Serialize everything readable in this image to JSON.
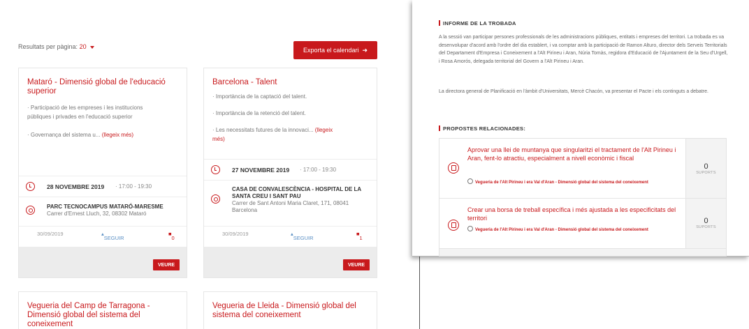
{
  "left": {
    "per_page_label": "Resultats per pàgina:",
    "per_page_value": "20",
    "export_label": "Exporta el calendari",
    "export_icon": "arrow-right-icon",
    "cards": [
      {
        "title": "Mataró - Dimensió global de l'educació superior",
        "lines": [
          "· Participació de les empreses i les institucions",
          "públiques i privades en l'educació superior",
          "· Governança del sistema u..."
        ],
        "more": "(llegeix més)",
        "date": "28 NOVEMBRE 2019",
        "time": "· 17:00 - 19:30",
        "place": "PARC TECNOCAMPUS MATARÓ-MARESME",
        "address": "Carrer d'Ernest Lluch, 32, 08302 Mataró",
        "pub_date": "30/09/2019",
        "follow": "SEGUIR",
        "count": "0",
        "button": "VEURE"
      },
      {
        "title": "Barcelona - Talent",
        "lines": [
          "· Importància de la captació del talent.",
          "· Importància de la retenció del talent.",
          "· Les necessitats futures de la innovaci..."
        ],
        "more": "(llegeix",
        "more2": "més)",
        "date": "27 NOVEMBRE 2019",
        "time": "· 17:00 - 19:30",
        "place": "CASA DE CONVALESCÈNCIA - HOSPITAL DE LA SANTA CREU I SANT PAU",
        "address": "Carrer de Sant Antoni Maria Claret, 171, 08041 Barcelona",
        "pub_date": "30/09/2019",
        "follow": "SEGUIR",
        "count": "1",
        "button": "VEURE"
      },
      {
        "title": "Vegueria del Camp de Tarragona - Dimensió global del sistema del coneixement"
      },
      {
        "title": "Vegueria de Lleida - Dimensió global del sistema del coneixement"
      }
    ]
  },
  "right": {
    "informe_heading": "INFORME DE LA TROBADA",
    "informe_p1": "A la sessió van participar persones professionals de les administracions públiques, entitats i empreses del territori. La trobada es va desenvolupar d'acord amb l'ordre del dia establert, i va comptar amb la participació de Ramon Alturo, director dels Serveis Territorials del Departament d'Empresa i Coneixement a l'Alt Pirineu i Aran, Núria Tomàs, regidora d'Educació de l'Ajuntament de la Seu d'Urgell, i Rosa Amorós, delegada territorial del Govern a l'Alt Pirineu i Aran.",
    "informe_p2": "La directora general de Planificació en l'àmbit d'Universitats, Mercè Chacón, va presentar el Pacte i els continguts a debatre.",
    "propostes_heading": "PROPOSTES RELACIONADES:",
    "propostes": [
      {
        "text": "Aprovar una llei de muntanya que singularitzi el tractament de l'Alt Pirineu i Aran, fent-lo atractiu, especialment a nivell econòmic i fiscal",
        "link": "Vegueria de l'Alt Pirineu i era Val d'Aran - Dimensió global del sistema del coneixement",
        "supports": "0",
        "supports_label": "SUPORTS"
      },
      {
        "text": "Crear una borsa de treball específica i més ajustada a les especificitats del territori",
        "link": "Vegueria de l'Alt Pirineu i era Val d'Aran - Dimensió global del sistema del coneixement",
        "supports": "0",
        "supports_label": "SUPORTS"
      }
    ]
  },
  "colors": {
    "accent": "#c8191c",
    "link_blue": "#5a8fc4",
    "panel_gray": "#ececec"
  }
}
